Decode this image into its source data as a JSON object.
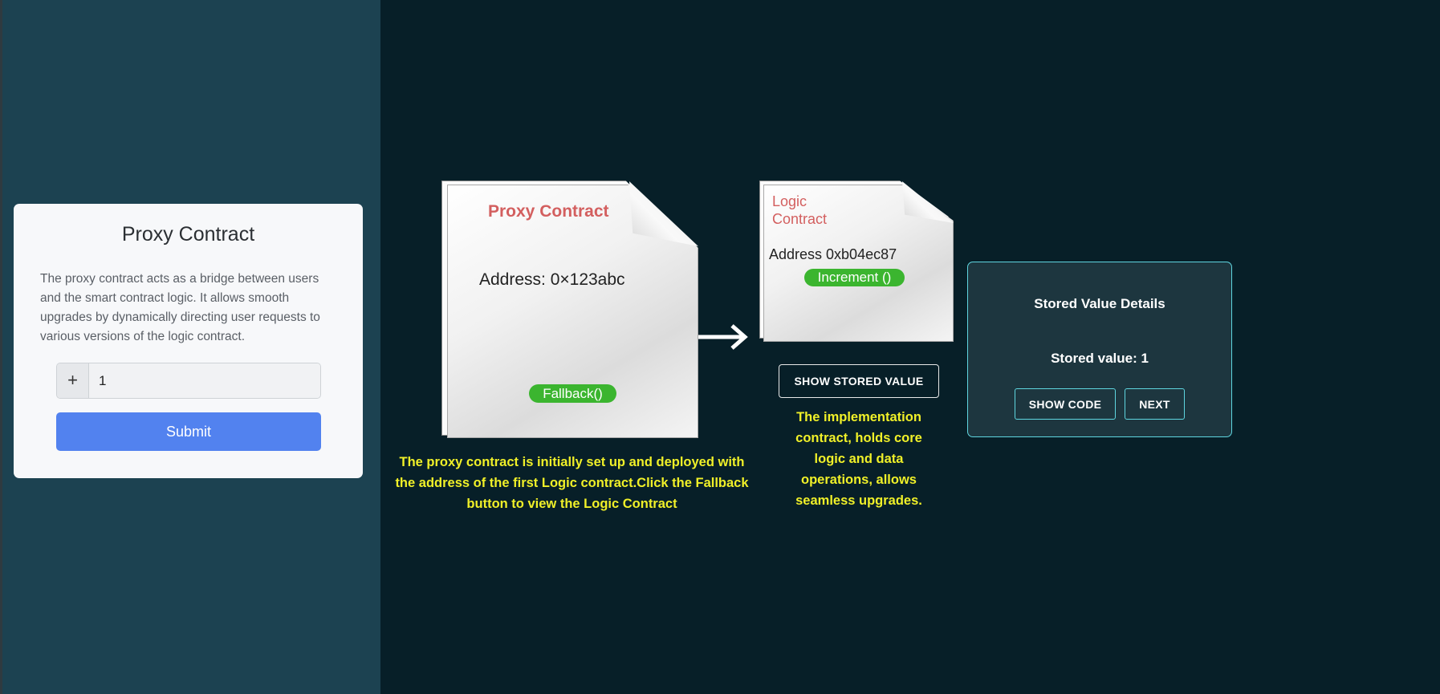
{
  "form": {
    "title": "Proxy Contract",
    "description": "The proxy contract acts as a bridge between users and the smart contract logic. It allows smooth upgrades by dynamically directing user requests to various versions of the logic contract.",
    "input_addon": "+",
    "input_value": "1",
    "submit_label": "Submit"
  },
  "proxy_doc": {
    "title": "Proxy Contract",
    "address": "Address: 0×123abc",
    "fallback_label": "Fallback()",
    "caption": "The proxy contract is initially set up and deployed with the address of the first Logic contract.Click the Fallback button to view the Logic Contract"
  },
  "logic_doc": {
    "title": "Logic Contract",
    "address": "Address 0xb04ec87",
    "increment_label": "Increment ()",
    "show_stored_label": "SHOW STORED VALUE",
    "caption": "The implementation contract, holds core logic and data operations, allows seamless upgrades."
  },
  "details": {
    "title": "Stored Value Details",
    "stored_value": "Stored value: 1",
    "show_code_label": "SHOW CODE",
    "next_label": "NEXT"
  },
  "colors": {
    "sidebar_bg": "#1c4251",
    "main_bg": "#071f28",
    "submit_bg": "#5282ef",
    "doc_title": "#d35f5f",
    "pill_green": "#3bb52f",
    "caption_yellow": "#f0f028",
    "details_border": "#5fd6e0"
  },
  "icons": {
    "arrow": "right-arrow-icon"
  }
}
